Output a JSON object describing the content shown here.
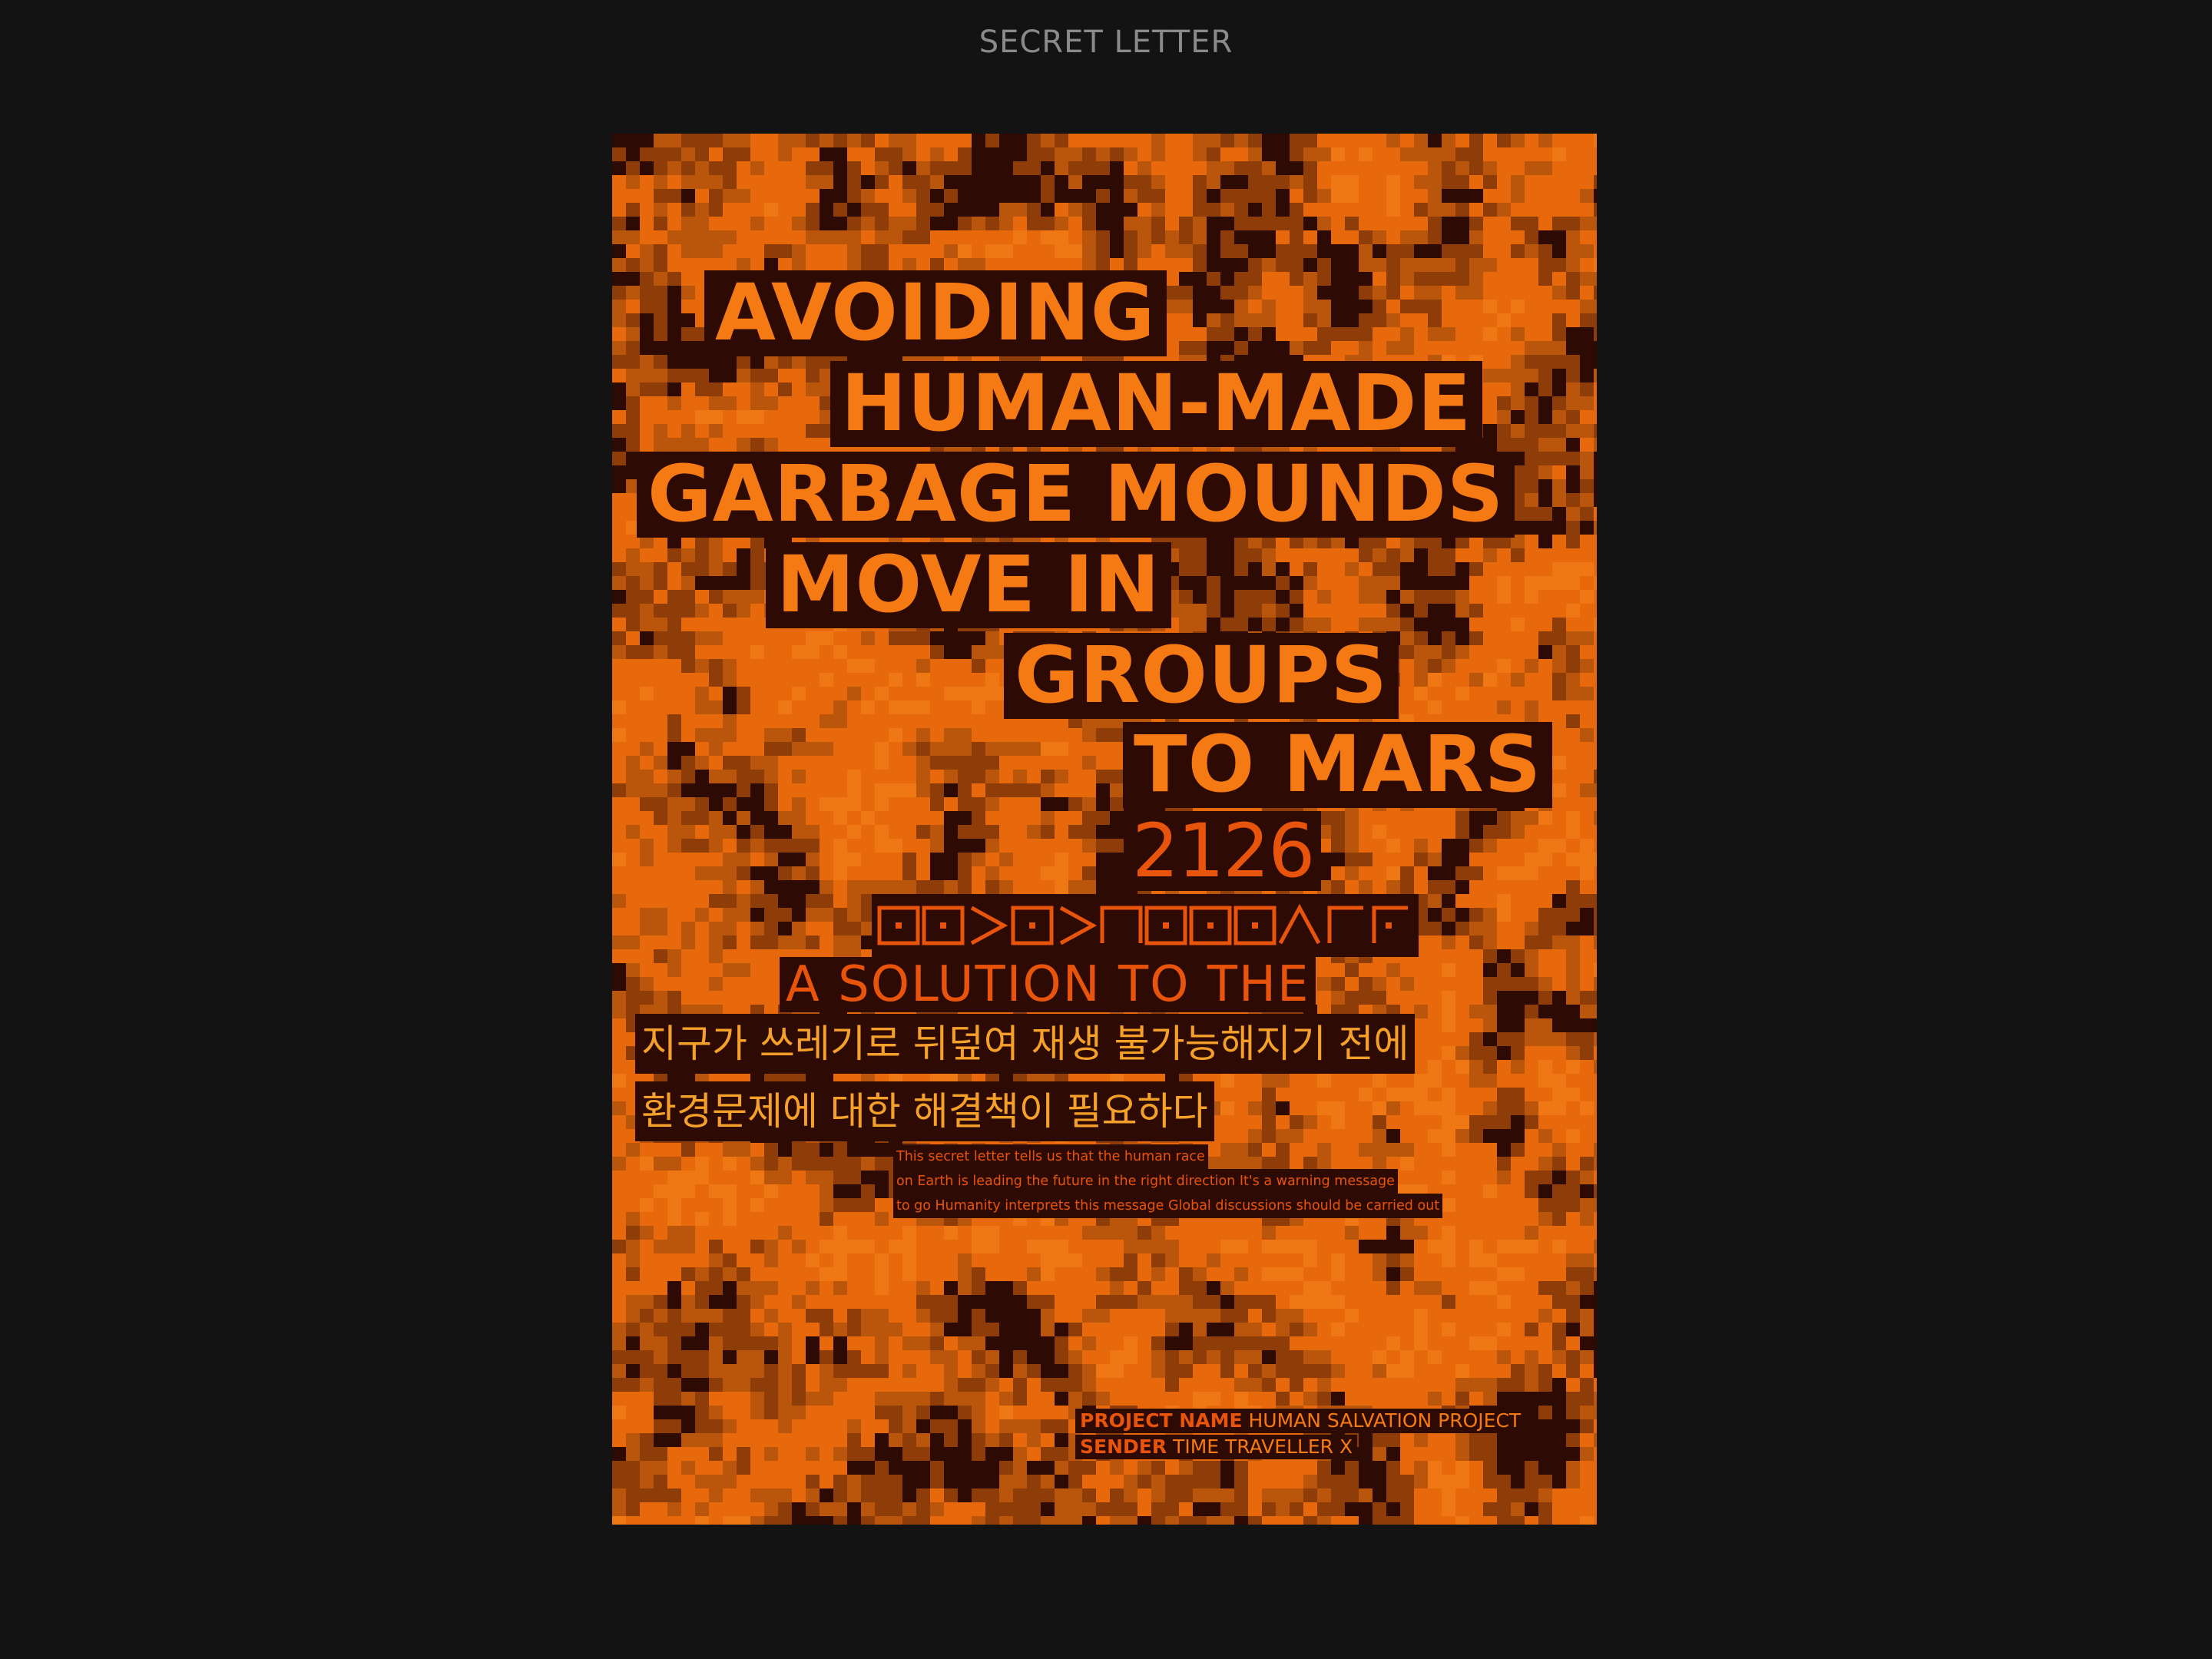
{
  "page": {
    "title": "SECRET LETTER"
  },
  "poster": {
    "headline": [
      "AVOIDING",
      "HUMAN-MADE",
      "GARBAGE MOUNDS",
      "MOVE IN",
      "GROUPS",
      "TO MARS"
    ],
    "year": "2126",
    "cipher_glyph_count": 12,
    "subtitle": "A SOLUTION TO THE",
    "korean_lines": [
      "지구가 쓰레기로 뒤덮여 재생 불가능해지기 전에",
      "환경문제에 대한 해결책이 필요하다"
    ],
    "body_lines": [
      "This secret letter tells us that the human race",
      "on Earth is leading the future in the right direction It's a warning message",
      "to go Humanity interprets this message Global discussions should be carried out"
    ],
    "project_label": "PROJECT NAME",
    "project_value": "HUMAN SALVATION PROJECT",
    "sender_label": "SENDER",
    "sender_value": "TIME TRAVELLER X"
  },
  "colors": {
    "page_background": "#131313",
    "title_gray": "#8a8a8a",
    "poster_orange": "#e8680c",
    "pixel_brown": "#b9560c",
    "pixel_dark": "#2e0a04",
    "text_orange": "#f67a14",
    "text_yellow": "#f5a028"
  }
}
